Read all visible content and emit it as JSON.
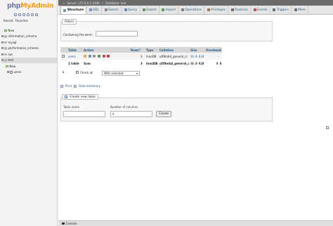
{
  "sidebar": {
    "logo_php": "php",
    "logo_myadmin": "MyAdmin",
    "recent": "Recent",
    "favorites": "Favorites",
    "tree": [
      {
        "label": "New",
        "expander": ""
      },
      {
        "label": "information_schema",
        "expander": "+"
      },
      {
        "label": "mysql",
        "expander": "+"
      },
      {
        "label": "performance_schema",
        "expander": "+"
      },
      {
        "label": "sys",
        "expander": "+"
      },
      {
        "label": "test",
        "expander": "−"
      },
      {
        "label": "New",
        "expander": ""
      },
      {
        "label": "users",
        "expander": "+"
      }
    ]
  },
  "breadcrumb": {
    "server": "Server: 127.0.0.1:3306",
    "database": "Database: test"
  },
  "tabs": [
    {
      "label": "Structure",
      "icon": "structure-icon",
      "color": "#7b8fb8"
    },
    {
      "label": "SQL",
      "icon": "sql-icon",
      "color": "#6f90c9"
    },
    {
      "label": "Search",
      "icon": "search-icon",
      "color": "#8a8a8a"
    },
    {
      "label": "Query",
      "icon": "query-icon",
      "color": "#5b8ac4"
    },
    {
      "label": "Export",
      "icon": "export-icon",
      "color": "#5a9a54"
    },
    {
      "label": "Import",
      "icon": "import-icon",
      "color": "#5a9a54"
    },
    {
      "label": "Operations",
      "icon": "operations-icon",
      "color": "#7f7f7f"
    },
    {
      "label": "Privileges",
      "icon": "privileges-icon",
      "color": "#9a7b52"
    },
    {
      "label": "Routines",
      "icon": "routines-icon",
      "color": "#6f6f6f"
    },
    {
      "label": "Events",
      "icon": "events-icon",
      "color": "#c55050"
    },
    {
      "label": "Triggers",
      "icon": "triggers-icon",
      "color": "#6f6f6f"
    },
    {
      "label": "More",
      "icon": "more-icon",
      "color": "#6f6f6f"
    }
  ],
  "filters": {
    "legend": "Filters",
    "label": "Containing the word:"
  },
  "table": {
    "headers": {
      "table": "Table",
      "action": "Action",
      "rows": "Rows",
      "type": "Type",
      "collation": "Collation",
      "size": "Size",
      "overhead": "Overhead"
    },
    "rows": [
      {
        "name": "users",
        "rows": "3",
        "type": "InnoDB",
        "collation": "utf8mb4_general_ci",
        "size": "16.0 KiB",
        "overhead": "-"
      }
    ],
    "total": {
      "label": "1 table",
      "rows": "Sum",
      "type": "InnoDB",
      "collation": "utf8mb4_general_ci",
      "size": "16.0 KiB",
      "overhead": "0 B"
    },
    "action_icons": [
      "browse-icon",
      "structure-icon",
      "search-icon",
      "insert-icon",
      "empty-icon",
      "drop-icon"
    ]
  },
  "bulk": {
    "check_all": "Check all",
    "with_selected": "With selected:"
  },
  "links": {
    "print": "Print",
    "data_dictionary": "Data dictionary"
  },
  "create": {
    "legend": "Create new table",
    "name_label": "Table name",
    "cols_label": "Number of columns",
    "cols_value": "4",
    "button": "Create"
  },
  "console": {
    "label": "Console"
  }
}
